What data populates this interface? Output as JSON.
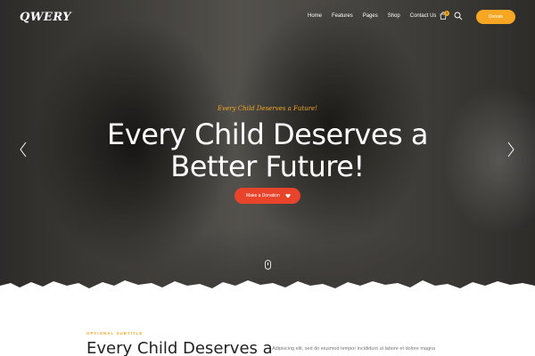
{
  "header": {
    "logo": "QWERY",
    "nav": [
      "Home",
      "Features",
      "Pages",
      "Shop",
      "Contact Us"
    ],
    "cart_count": "0",
    "donate_label": "Donate"
  },
  "hero": {
    "tagline": "Every Child Deserves a Future!",
    "headline": "Every Child Deserves a Better Future!",
    "cta_label": "Make a Donation"
  },
  "section": {
    "subtitle": "OPTIONAL SUBTITLE",
    "title": "Every Child Deserves a",
    "text": "Adipiscing elit, sed do eiusmod tempor incididunt ut labore et dolore magna"
  },
  "colors": {
    "accent": "#f5a623",
    "cta": "#e8442b",
    "text_dark": "#222222"
  },
  "icons": [
    "cart-icon",
    "search-icon",
    "heart-icon",
    "chevron-left-icon",
    "chevron-right-icon",
    "scroll-mouse-icon"
  ]
}
